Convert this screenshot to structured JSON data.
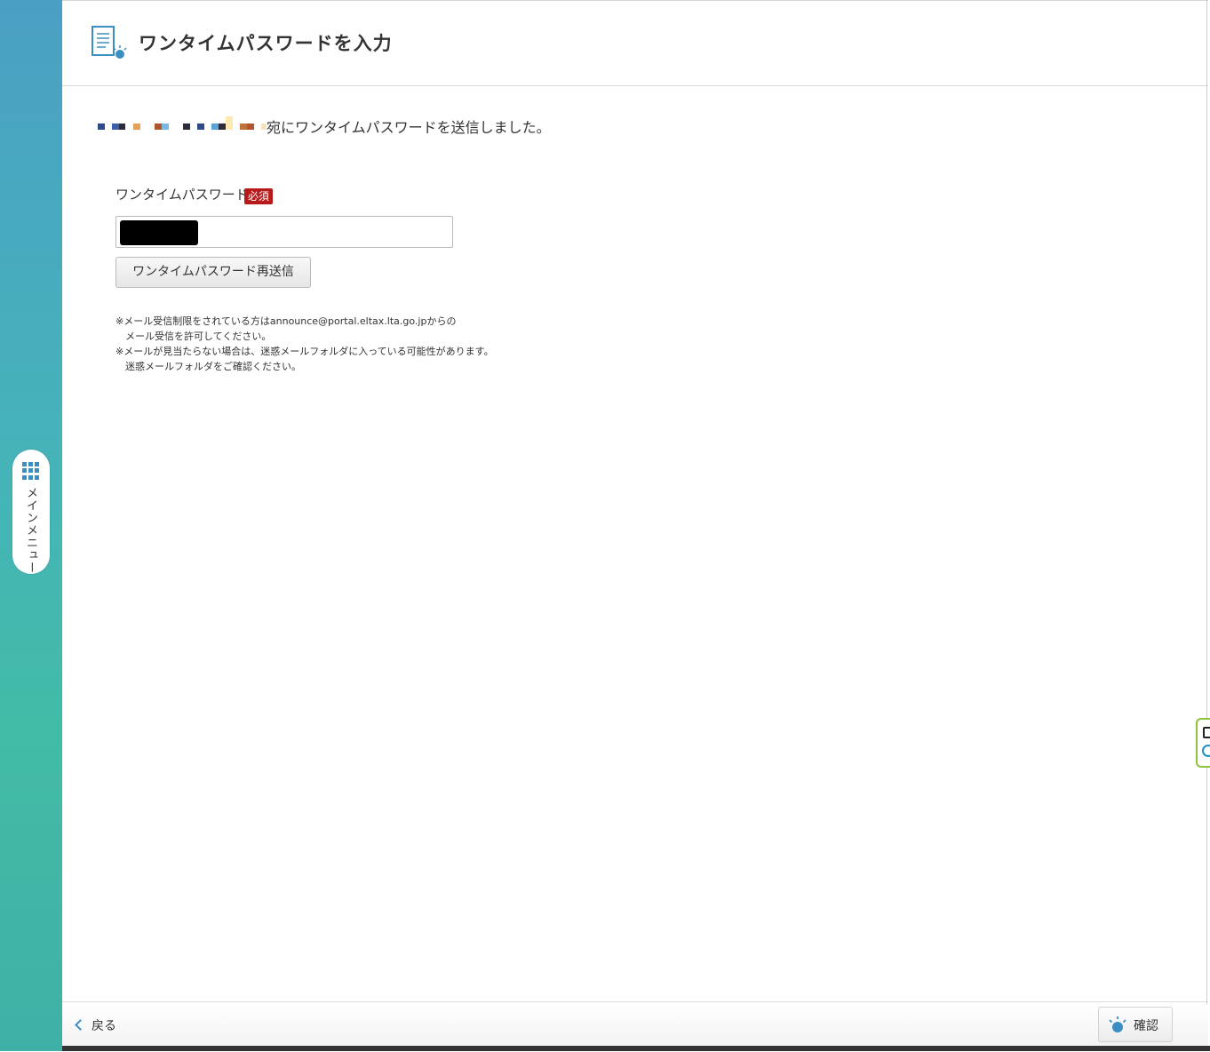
{
  "header": {
    "title": "ワンタイムパスワードを入力",
    "icon": "document-with-eye-icon"
  },
  "sent_message": {
    "email_masked": true,
    "text": "宛にワンタイムパスワードを送信しました。"
  },
  "form": {
    "label": "ワンタイムパスワード",
    "required_badge": "必須",
    "resend_button": "ワンタイムパスワード再送信"
  },
  "notes": {
    "text": "※メール受信制限をされている方はannounce@portal.eltax.lta.go.jpからの\n　メール受信を許可してください。\n※メールが見当たらない場合は、迷惑メールフォルダに入っている可能性があります。\n　迷惑メールフォルダをご確認ください。"
  },
  "sidebar": {
    "menu_label": "メインメニュー",
    "menu_icon": "grid-icon"
  },
  "footer": {
    "back_label": "戻る",
    "confirm_label": "確認",
    "confirm_icon": "eye-icon"
  },
  "colors": {
    "accent": "#3a8fc0",
    "required": "#b8191b",
    "sidebar_top": "#4aa0c4",
    "sidebar_bottom": "#42bca6"
  }
}
